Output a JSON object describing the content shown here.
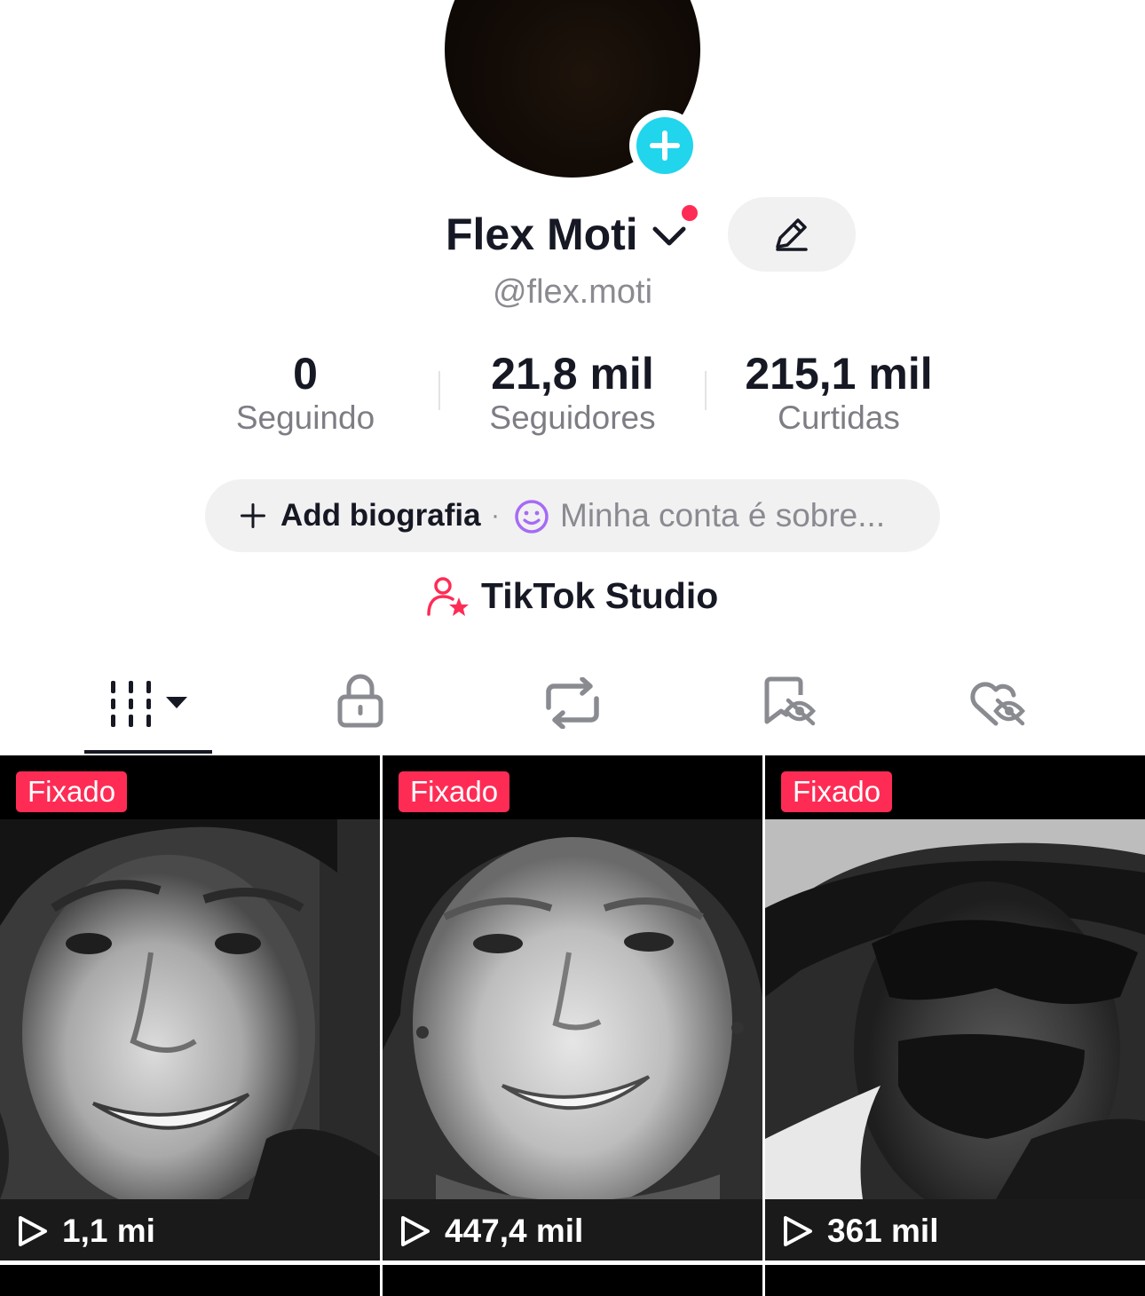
{
  "profile": {
    "display_name": "Flex Moti",
    "username": "@flex.moti"
  },
  "stats": [
    {
      "value": "0",
      "label": "Seguindo"
    },
    {
      "value": "21,8 mil",
      "label": "Seguidores"
    },
    {
      "value": "215,1 mil",
      "label": "Curtidas"
    }
  ],
  "bio": {
    "add_label": "Add biografia",
    "separator": "·",
    "placeholder": "Minha conta é sobre..."
  },
  "studio": {
    "label": "TikTok Studio"
  },
  "tabs": [
    {
      "icon": "videos-grid-icon",
      "selected": true
    },
    {
      "icon": "lock-icon",
      "selected": false
    },
    {
      "icon": "repost-icon",
      "selected": false
    },
    {
      "icon": "favorites-hidden-icon",
      "selected": false
    },
    {
      "icon": "liked-hidden-icon",
      "selected": false
    }
  ],
  "videos": [
    {
      "badge": "Fixado",
      "views": "1,1 mi"
    },
    {
      "badge": "Fixado",
      "views": "447,4 mil"
    },
    {
      "badge": "Fixado",
      "views": "361 mil"
    }
  ],
  "colors": {
    "accent": "#fe2c55",
    "add_avatar": "#20d5ec",
    "secondary_text": "#8a8b91"
  }
}
